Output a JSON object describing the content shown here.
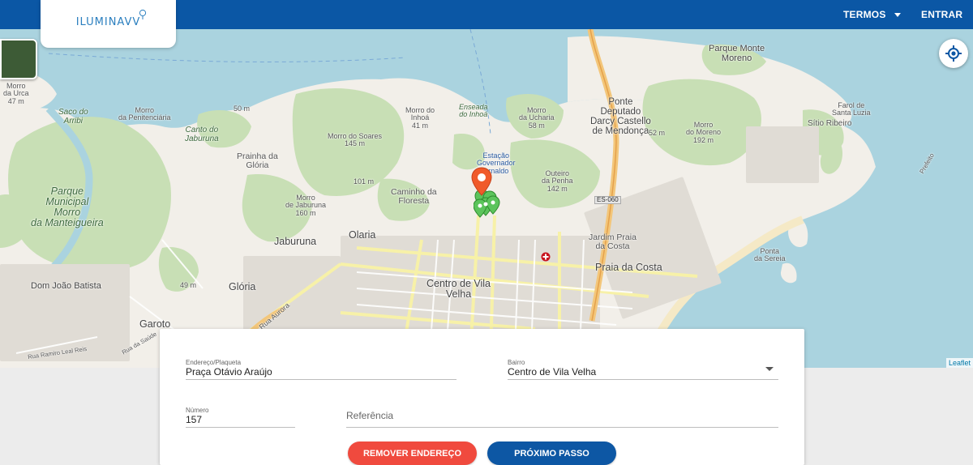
{
  "brand": {
    "logo_text": "ILUMINAVV"
  },
  "nav": {
    "terms_label": "TERMOS",
    "login_label": "ENTRAR"
  },
  "map": {
    "labels": {
      "morro_urca": "Morro\nda Urca\n47 m",
      "saco_arribi": "Saco do\nArribi",
      "morro_penitenciaria": "Morro\nda Penitenciária",
      "canto_jaburuna": "Canto do\nJaburuna",
      "alt_50": "50 m",
      "morro_inhoa": "Morro do\nInhoá\n41 m",
      "enseada_inhoa": "Enseada\ndo Inhoá",
      "morro_ucharia": "Morro\nda Ucharia\n58 m",
      "ponte": "Ponte\nDeputado\nDarcy Castello\nde Mendonça",
      "alt_52": "52 m",
      "morro_moreno": "Morro\ndo Moreno\n192 m",
      "parque_morro_moreno": "Parque Monte\nMoreno",
      "farol_santa_luzia": "Farol de\nSanta Luzia",
      "sitio_ribeiro": "Sítio Ribeiro",
      "morro_soares": "Morro do Soares\n145 m",
      "prainha_gloria": "Prainha da\nGlória",
      "alt_101": "101 m",
      "estacao": "Estação\nGovernador\nArnaldo",
      "outeiro_penha": "Outeiro\nda Penha\n142 m",
      "parque_municipal": "Parque\nMunicipal\nMorro\nda Manteigueira",
      "caminho_floresta": "Caminho da\nFloresta",
      "morro_jaburuna": "Morro\nde Jaburuna\n160 m",
      "es060": "ES-060",
      "jaburuna": "Jaburuna",
      "olaria": "Olaria",
      "jardim_praia": "Jardim Praia\nda Costa",
      "praia_costa": "Praia da Costa",
      "ponta_sereia": "Ponta\nda Sereia",
      "gloria": "Glória",
      "alt_49": "49 m",
      "dom_joao": "Dom João Batista",
      "centro": "Centro de Vila\nVelha",
      "garoto": "Garoto",
      "rua_aurora": "Rua Aurora",
      "rua_ramiro": "Rua Ramiro Leal Reis",
      "rua_saude": "Rua da Saúde",
      "prefeito": "Prefeito"
    },
    "attribution": "Leaflet"
  },
  "form": {
    "address": {
      "label": "Endereço/Plaqueta",
      "value": "Praça Otávio Araújo"
    },
    "district": {
      "label": "Bairro",
      "value": "Centro de Vila Velha"
    },
    "number": {
      "label": "Número",
      "value": "157"
    },
    "reference": {
      "placeholder": "Referência"
    }
  },
  "actions": {
    "remove_label": "REMOVER ENDEREÇO",
    "next_label": "PRÓXIMO PASSO"
  },
  "colors": {
    "header": "#0b57a5",
    "remove": "#f04a3e",
    "next": "#0d57a4",
    "pin_selected": "#f05a2a",
    "pin_cluster": "#4caf50"
  }
}
